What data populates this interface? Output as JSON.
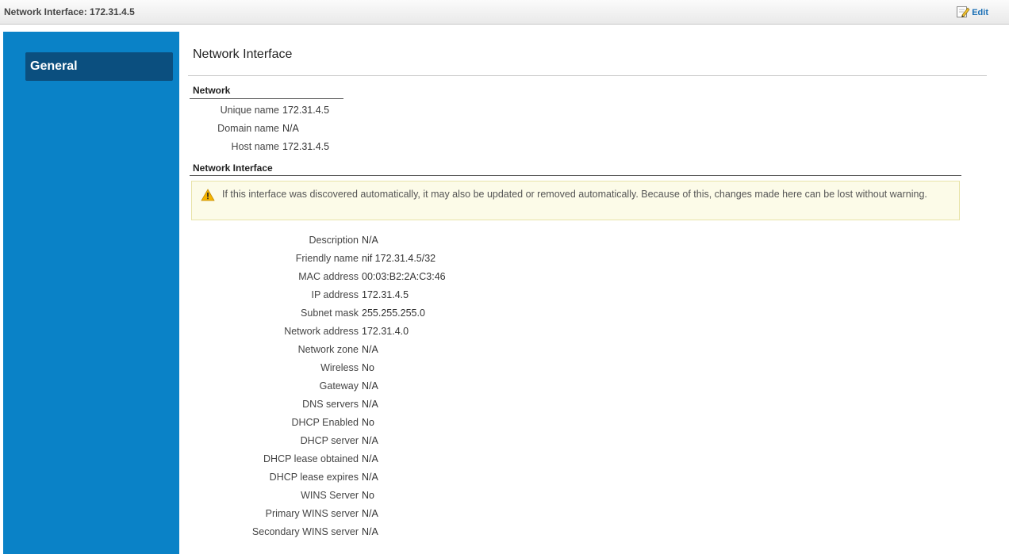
{
  "window": {
    "title": "Network Interface: 172.31.4.5",
    "edit_label": "Edit"
  },
  "sidebar": {
    "items": [
      {
        "label": "General"
      }
    ]
  },
  "main": {
    "heading": "Network Interface",
    "network_section": {
      "title": "Network",
      "fields": [
        {
          "label": "Unique name",
          "value": "172.31.4.5"
        },
        {
          "label": "Domain name",
          "value": "N/A"
        },
        {
          "label": "Host name",
          "value": "172.31.4.5"
        }
      ]
    },
    "interface_section": {
      "title": "Network Interface",
      "warning": "If this interface was discovered automatically, it may also be updated or removed automatically. Because of this, changes made here can be lost without warning.",
      "fields": [
        {
          "label": "Description",
          "value": "N/A"
        },
        {
          "label": "Friendly name",
          "value": "nif 172.31.4.5/32"
        },
        {
          "label": "MAC address",
          "value": "00:03:B2:2A:C3:46"
        },
        {
          "label": "IP address",
          "value": "172.31.4.5"
        },
        {
          "label": "Subnet mask",
          "value": "255.255.255.0"
        },
        {
          "label": "Network address",
          "value": "172.31.4.0"
        },
        {
          "label": "Network zone",
          "value": "N/A"
        },
        {
          "label": "Wireless",
          "value": "No"
        },
        {
          "label": "Gateway",
          "value": "N/A"
        },
        {
          "label": "DNS servers",
          "value": "N/A"
        },
        {
          "label": "DHCP Enabled",
          "value": "No"
        },
        {
          "label": "DHCP server",
          "value": "N/A"
        },
        {
          "label": "DHCP lease obtained",
          "value": "N/A"
        },
        {
          "label": "DHCP lease expires",
          "value": "N/A"
        },
        {
          "label": "WINS Server",
          "value": "No"
        },
        {
          "label": "Primary WINS server",
          "value": "N/A"
        },
        {
          "label": "Secondary WINS server",
          "value": "N/A"
        }
      ]
    }
  },
  "colors": {
    "sidebar": "#0a82c7",
    "sidebar_active": "#0b4f7f",
    "warning_bg": "#fcfbe8",
    "link": "#1a6fb5"
  },
  "icons": {
    "edit": "edit-icon",
    "warning": "warning-icon"
  }
}
